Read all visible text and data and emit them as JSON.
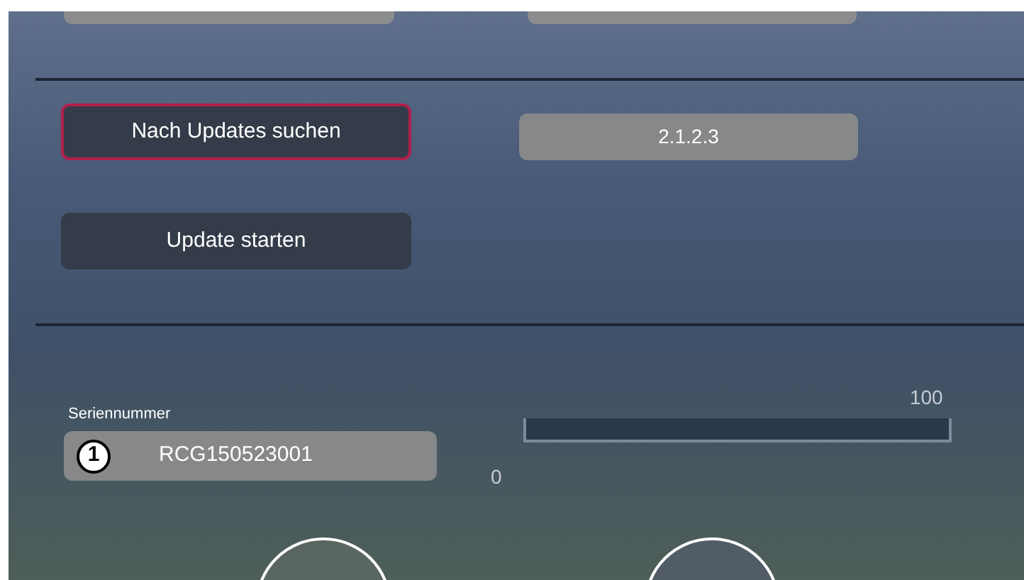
{
  "update_section": {
    "check_button": {
      "label": "Nach Updates suchen",
      "focused": true
    },
    "version": "2.1.2.3",
    "start_button": {
      "label": "Update starten",
      "focused": false
    }
  },
  "serial": {
    "label": "Seriennummer",
    "marker": "1",
    "value": "RCG150523001"
  },
  "progress": {
    "max_label": "100",
    "min_label": "0",
    "level": 0
  }
}
